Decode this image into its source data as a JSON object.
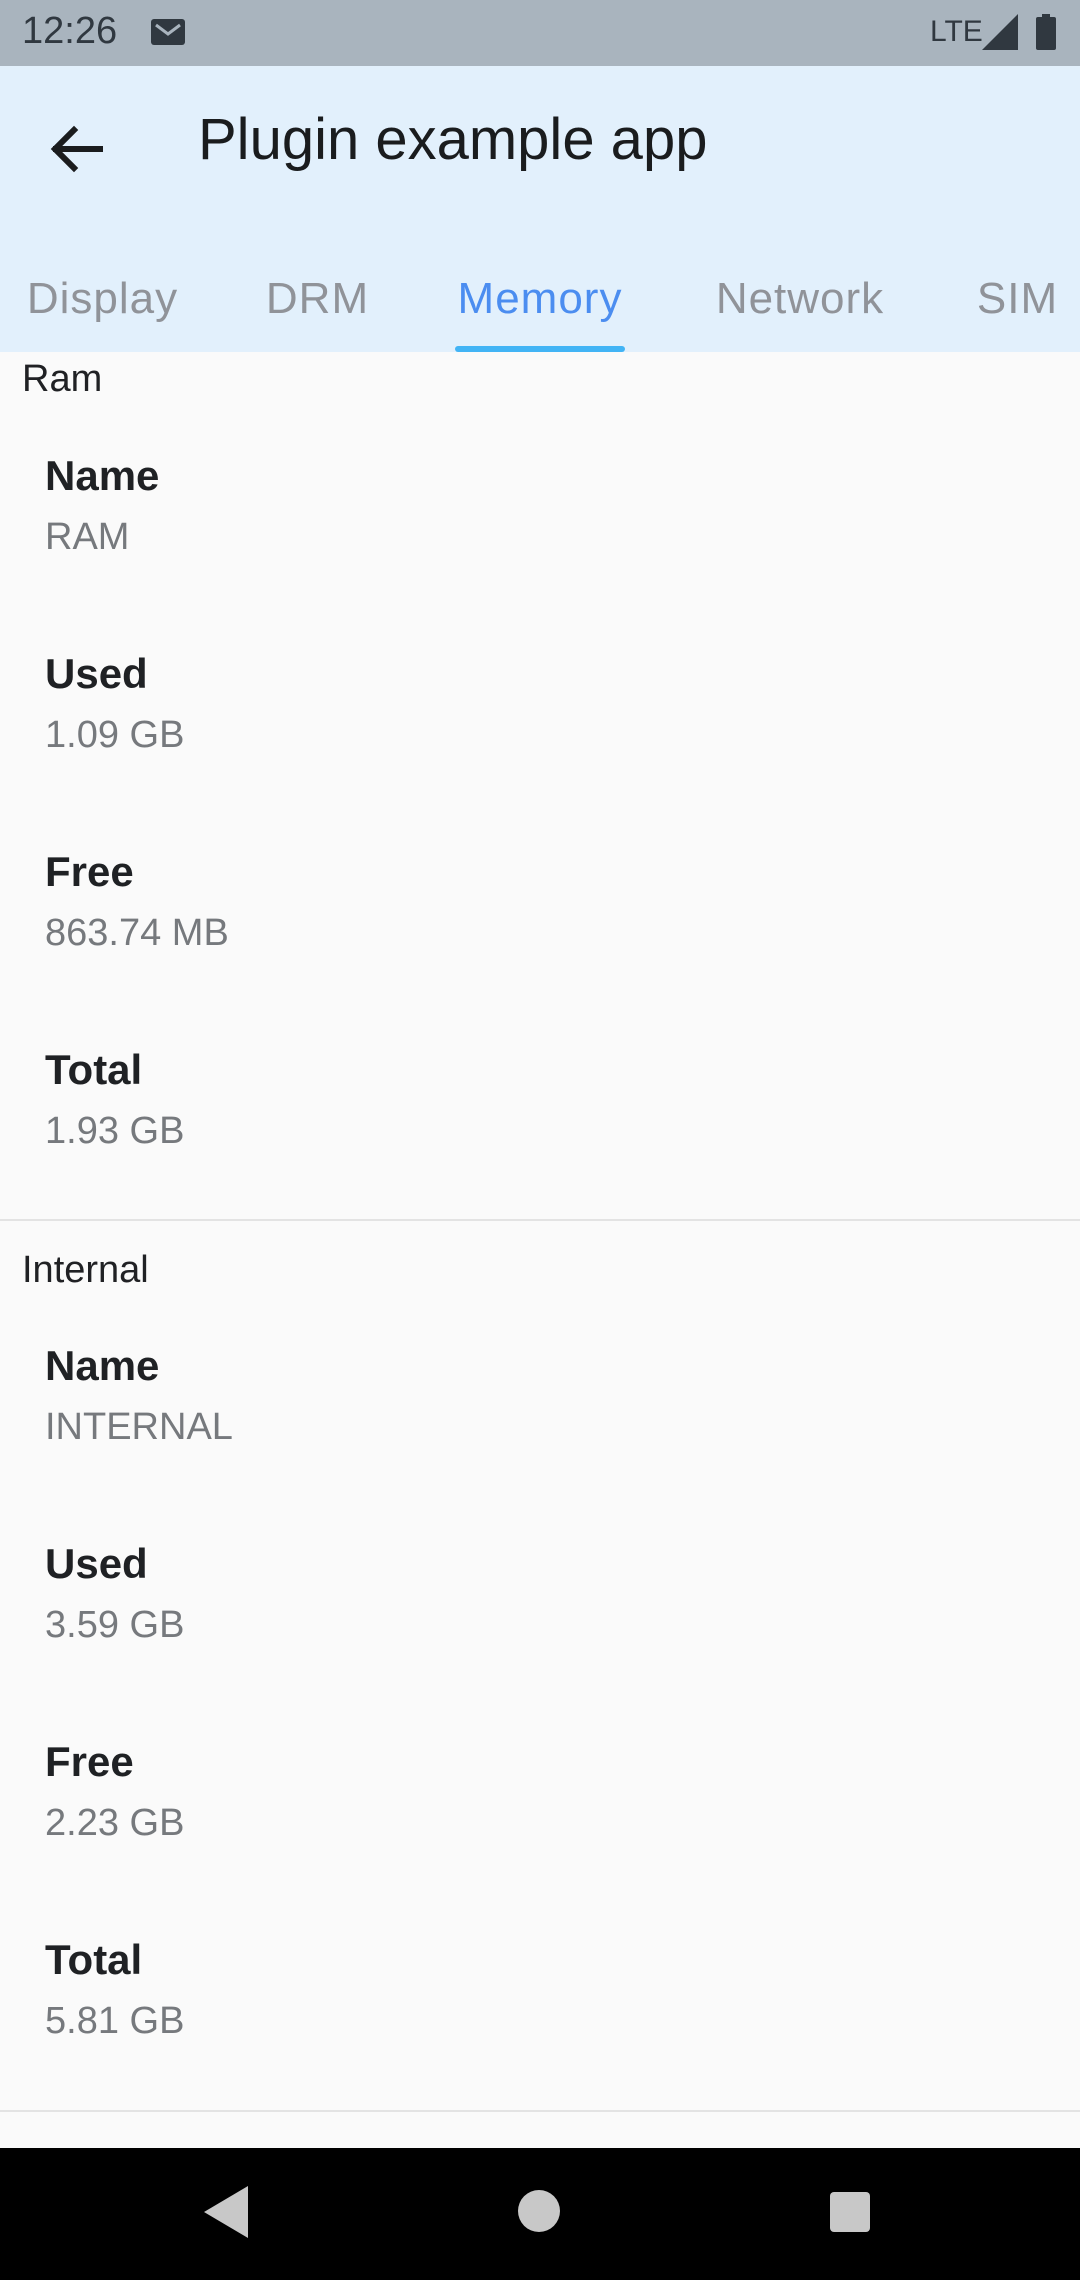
{
  "status_bar": {
    "time": "12:26",
    "network": "LTE"
  },
  "app_bar": {
    "title": "Plugin example app"
  },
  "tabs": [
    {
      "label": "Display"
    },
    {
      "label": "DRM"
    },
    {
      "label": "Memory",
      "active": true
    },
    {
      "label": "Network"
    },
    {
      "label": "SIM"
    }
  ],
  "sections": [
    {
      "title": "Ram",
      "items": [
        {
          "label": "Name",
          "value": "RAM"
        },
        {
          "label": "Used",
          "value": "1.09 GB"
        },
        {
          "label": "Free",
          "value": "863.74 MB"
        },
        {
          "label": "Total",
          "value": "1.93 GB"
        }
      ]
    },
    {
      "title": "Internal",
      "items": [
        {
          "label": "Name",
          "value": "INTERNAL"
        },
        {
          "label": "Used",
          "value": "3.59 GB"
        },
        {
          "label": "Free",
          "value": "2.23 GB"
        },
        {
          "label": "Total",
          "value": "5.81 GB"
        }
      ]
    }
  ],
  "colors": {
    "app_bar_bg": "#e2f0fc",
    "tab_active": "#4b8df0",
    "tab_indicator": "#42b4f5",
    "tab_inactive": "#909399"
  }
}
